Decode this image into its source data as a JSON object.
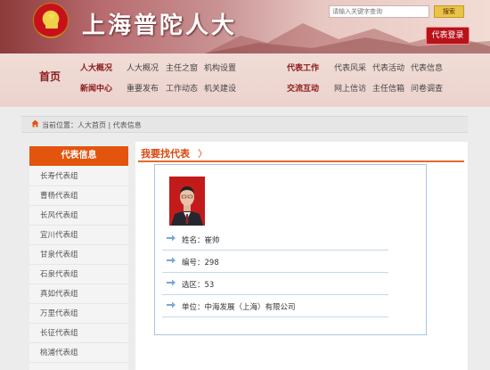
{
  "header": {
    "site_title": "上海普陀人大",
    "search_placeholder": "请输入关键字查询",
    "search_button": "搜索",
    "rep_login_button": "代表登录"
  },
  "nav": {
    "home": "首页",
    "cat_overview": "人大概况",
    "cat_news": "新闻中心",
    "cat_rep_work": "代表工作",
    "cat_interaction": "交流互动",
    "overview_links": [
      "人大概况",
      "主任之窗",
      "机构设置"
    ],
    "news_links": [
      "重要发布",
      "工作动态",
      "机关建设"
    ],
    "rep_work_links": [
      "代表风采",
      "代表活动",
      "代表信息"
    ],
    "interaction_links": [
      "网上信访",
      "主任信箱",
      "问卷调查"
    ]
  },
  "breadcrumb": "当前位置：人大首页 | 代表信息",
  "sidebar": {
    "title": "代表信息",
    "items": [
      "长寿代表组",
      "曹杨代表组",
      "长风代表组",
      "宜川代表组",
      "甘泉代表组",
      "石泉代表组",
      "真如代表组",
      "万里代表组",
      "长征代表组",
      "桃浦代表组"
    ]
  },
  "main": {
    "section_title": "我要找代表",
    "section_arrow": "〉",
    "rep": {
      "name": "姓名：崔帅",
      "id": "编号：298",
      "district": "选区：53",
      "org": "单位：中海发展（上海）有限公司"
    }
  },
  "colors": {
    "accent_orange": "#e3540e",
    "brand_red": "#b8121a",
    "nav_red": "#8a1a1a",
    "card_border": "#a9c6e0"
  },
  "icons": [
    "national-emblem-icon",
    "home-icon",
    "arrow-right-icon"
  ]
}
